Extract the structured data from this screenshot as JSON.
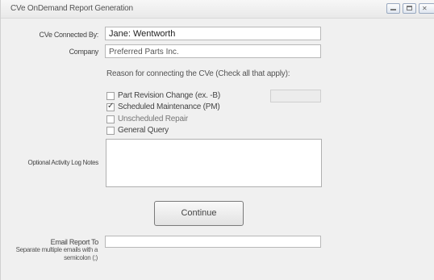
{
  "window": {
    "title": "CVe OnDemand Report Generation"
  },
  "form": {
    "cve_label": "CVe Connected By:",
    "cve_value": "Jane: Wentworth",
    "company_label": "Company",
    "company_value": "Preferred Parts Inc.",
    "reason_heading": "Reason for connecting the CVe (Check all that apply):",
    "reasons": [
      {
        "label": "Part Revision Change (ex. -B)",
        "checked": false
      },
      {
        "label": "Scheduled Maintenance (PM)",
        "checked": true
      },
      {
        "label": "Unscheduled Repair",
        "checked": false
      },
      {
        "label": "General Query",
        "checked": false
      }
    ],
    "notes_label": "Optional Activity Log Notes",
    "notes_value": "",
    "continue_label": "Continue",
    "email_label": "Email Report To",
    "email_value": "",
    "email_hint": "Separate multiple emails with a semicolon (;)"
  }
}
